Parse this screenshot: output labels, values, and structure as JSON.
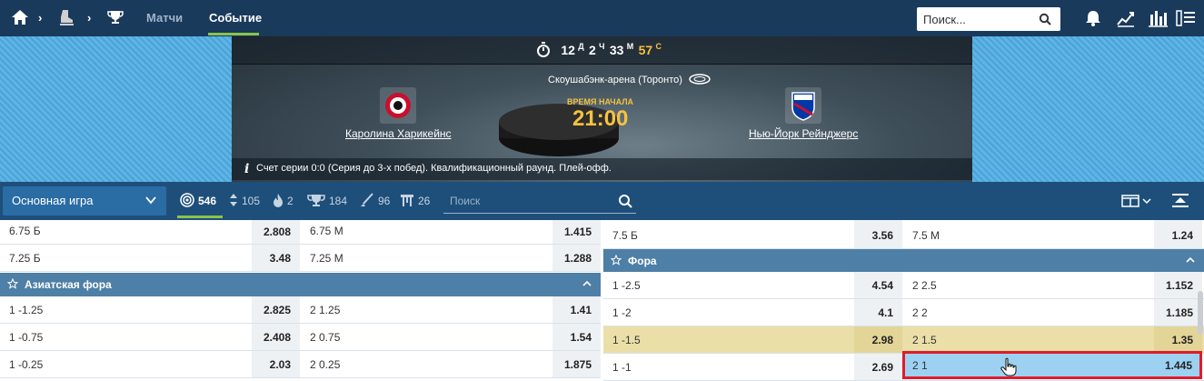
{
  "nav": {
    "links": [
      {
        "label": "Матчи",
        "active": false
      },
      {
        "label": "Событие",
        "active": true
      }
    ],
    "search_placeholder": "Поиск..."
  },
  "event": {
    "timer": {
      "days": "12",
      "days_unit": "Д",
      "hours": "2",
      "hours_unit": "Ч",
      "minutes": "33",
      "minutes_unit": "М",
      "seconds": "57",
      "seconds_unit": "С"
    },
    "venue": "Скоушабэнк-арена (Торонто)",
    "start_label": "ВРЕМЯ НАЧАЛА",
    "start_time": "21:00",
    "home_team": "Каролина Харикейнс",
    "away_team": "Нью-Йорк Рейнджерс",
    "series_info": "Счет серии 0:0 (Серия до 3-х побед). Квалификационный раунд. Плей-офф."
  },
  "filters": {
    "market_select": "Основная игра",
    "items": [
      {
        "icon": "target-icon",
        "count": "546",
        "active": true
      },
      {
        "icon": "updown-icon",
        "count": "105",
        "active": false
      },
      {
        "icon": "fire-icon",
        "count": "2",
        "active": false
      },
      {
        "icon": "trophy-icon",
        "count": "184",
        "active": false
      },
      {
        "icon": "stick-icon",
        "count": "96",
        "active": false
      },
      {
        "icon": "gate-icon",
        "count": "26",
        "active": false
      }
    ],
    "search_placeholder": "Поиск"
  },
  "left": {
    "top_rows": [
      {
        "a": "6.75 Б",
        "ao": "2.808",
        "b": "6.75 М",
        "bo": "1.415"
      },
      {
        "a": "7.25 Б",
        "ao": "3.48",
        "b": "7.25 М",
        "bo": "1.288"
      }
    ],
    "section": "Азиатская фора",
    "rows": [
      {
        "a": "1 -1.25",
        "ao": "2.825",
        "b": "2 1.25",
        "bo": "1.41"
      },
      {
        "a": "1 -0.75",
        "ao": "2.408",
        "b": "2 0.75",
        "bo": "1.54"
      },
      {
        "a": "1 -0.25",
        "ao": "2.03",
        "b": "2 0.25",
        "bo": "1.875"
      }
    ]
  },
  "right": {
    "top_row": {
      "a": "7.5 Б",
      "ao": "3.56",
      "b": "7.5 М",
      "bo": "1.24"
    },
    "section": "Фора",
    "rows": [
      {
        "a": "1 -2.5",
        "ao": "4.54",
        "b": "2 2.5",
        "bo": "1.152"
      },
      {
        "a": "1 -2",
        "ao": "4.1",
        "b": "2 2",
        "bo": "1.185"
      },
      {
        "a": "1 -1.5",
        "ao": "2.98",
        "b": "2 1.5",
        "bo": "1.35"
      },
      {
        "a": "1 -1",
        "ao": "2.69",
        "b": "2 1",
        "bo": "1.445"
      }
    ]
  },
  "colors": {
    "nav_bg": "#1a3a5c",
    "accent_green": "#8bc34a",
    "section_bg": "#4e7fa6",
    "highlight": "#ebdfa8",
    "selected": "#9cd1f1",
    "selected_border": "#e21b2a",
    "timer_yellow": "#f6c23e"
  }
}
